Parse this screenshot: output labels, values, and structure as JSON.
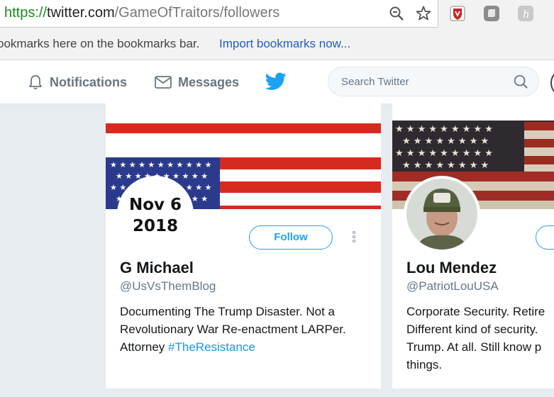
{
  "browser": {
    "url_scheme": "https://",
    "url_host": "twitter.com",
    "url_path": "/GameOfTraitors/followers",
    "bookmarks_hint": "ookmarks here on the bookmarks bar.",
    "bookmarks_link": "Import bookmarks now..."
  },
  "nav": {
    "notifications": "Notifications",
    "messages": "Messages",
    "search_placeholder": "Search Twitter"
  },
  "cards": [
    {
      "avatar_text_line1": "Nov 6",
      "avatar_text_line2": "2018",
      "follow_label": "Follow",
      "name": "G Michael",
      "handle": "@UsVsThemBlog",
      "bio_text": "Documenting The Trump Disaster. Not a\nRevolutionary War Re-enactment LARPer.\nAttorney ",
      "bio_hashtag": "#TheResistance"
    },
    {
      "name": "Lou Mendez",
      "handle": "@PatriotLouUSA",
      "bio_text": "Corporate Security. Retire\nDifferent kind of security.\nTrump. At all. Still know p\nthings."
    }
  ],
  "colors": {
    "twitter_blue": "#1da1f2",
    "link_blue": "#1b95e0",
    "flag_red": "#d52b1e",
    "flag_blue": "#2b3a8c",
    "page_bg": "#e6ecf0"
  }
}
